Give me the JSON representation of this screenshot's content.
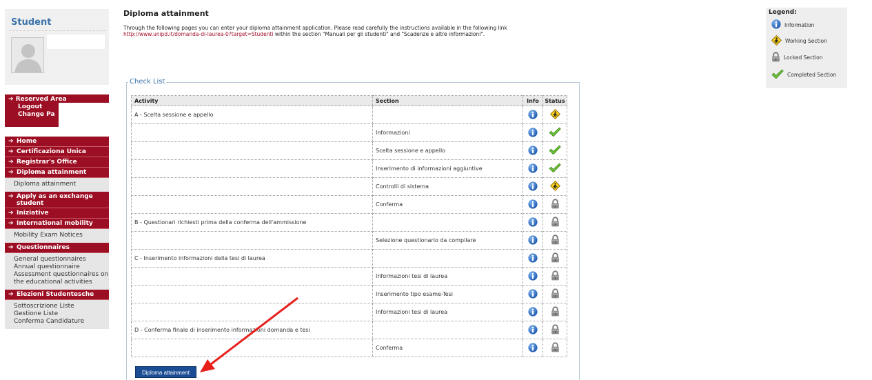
{
  "sidebar": {
    "student_title": "Student",
    "reserved": {
      "title": "Reserved Area",
      "logout": "Logout",
      "change": "Change Pa"
    },
    "menu": [
      {
        "label": "Home"
      },
      {
        "label": "Certificaziona Unica"
      },
      {
        "label": "Registrar's Office"
      },
      {
        "label": "Diploma attainment",
        "sub": [
          "Diploma attainment"
        ]
      },
      {
        "label": "Apply as an exchange student"
      },
      {
        "label": "Iniziative"
      },
      {
        "label": "International mobility",
        "sub": [
          "Mobility Exam Notices"
        ]
      },
      {
        "label": "Questionnaires",
        "sub": [
          "General questionnaires",
          "Annual questionnaire",
          "Assessment questionnaires on the educational activities"
        ]
      },
      {
        "label": "Elezioni Studentesche",
        "sub": [
          "Sottoscrizione Liste",
          "Gestione Liste",
          "Conferma Candidature"
        ]
      }
    ]
  },
  "main": {
    "title": "Diploma attainment",
    "intro_text": "Through the following pages you can enter your diploma attainment application. Please read carefully the instructions available in the following link",
    "intro_link": "http://www.unipd.it/domanda-di-laurea-0?target=Studenti",
    "intro_tail": " within the section \"Manuali per gli studenti\" and \"Scadenze e altre informazioni\".",
    "checklist_legend": "Check List",
    "columns": {
      "activity": "Activity",
      "section": "Section",
      "info": "Info",
      "status": "Status"
    },
    "rows": [
      {
        "activity": "A - Scelta sessione e appello",
        "section": "",
        "status": "working"
      },
      {
        "activity": "",
        "section": "Informazioni",
        "status": "completed"
      },
      {
        "activity": "",
        "section": "Scelta sessione e appello",
        "status": "completed"
      },
      {
        "activity": "",
        "section": "Inserimento di informazioni aggiuntive",
        "status": "completed"
      },
      {
        "activity": "",
        "section": "Controlli di sistema",
        "status": "working"
      },
      {
        "activity": "",
        "section": "Conferma",
        "status": "locked"
      },
      {
        "activity": "B - Questionari richiesti prima della conferma dell'ammissione",
        "section": "",
        "status": "locked"
      },
      {
        "activity": "",
        "section": "Selezione questionario da compilare",
        "status": "locked"
      },
      {
        "activity": "C - Inserimento informazioni della tesi di laurea",
        "section": "",
        "status": "locked"
      },
      {
        "activity": "",
        "section": "Informazioni tesi di laurea",
        "status": "locked"
      },
      {
        "activity": "",
        "section": "Inserimento tipo esame-Tesi",
        "status": "locked"
      },
      {
        "activity": "",
        "section": "Informazioni tesi di laurea",
        "status": "locked"
      },
      {
        "activity": "D - Conferma finale di inserimento informazioni domanda e tesi",
        "section": "",
        "status": "locked"
      },
      {
        "activity": "",
        "section": "Conferma",
        "status": "locked"
      }
    ],
    "button_label": "Diploma attainment"
  },
  "legend": {
    "title": "Legend:",
    "information": "Information",
    "working": "Working Section",
    "locked": "Locked Section",
    "completed": "Completed Section"
  },
  "colors": {
    "menu_red": "#9c0e23",
    "link_red": "#a01028",
    "student_blue": "#3c73a8",
    "button_blue": "#1a4d94",
    "annotation_arrow": "#e8201c"
  }
}
